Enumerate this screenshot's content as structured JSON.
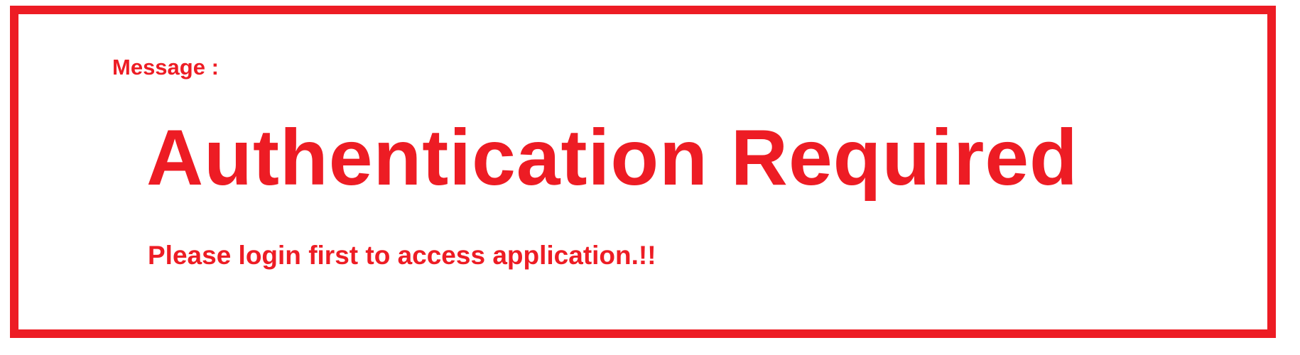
{
  "message": {
    "label": "Message :",
    "title": "Authentication Required",
    "detail": "Please login first to access application.!!"
  },
  "colors": {
    "accent": "#ed1c24",
    "background": "#ffffff"
  }
}
